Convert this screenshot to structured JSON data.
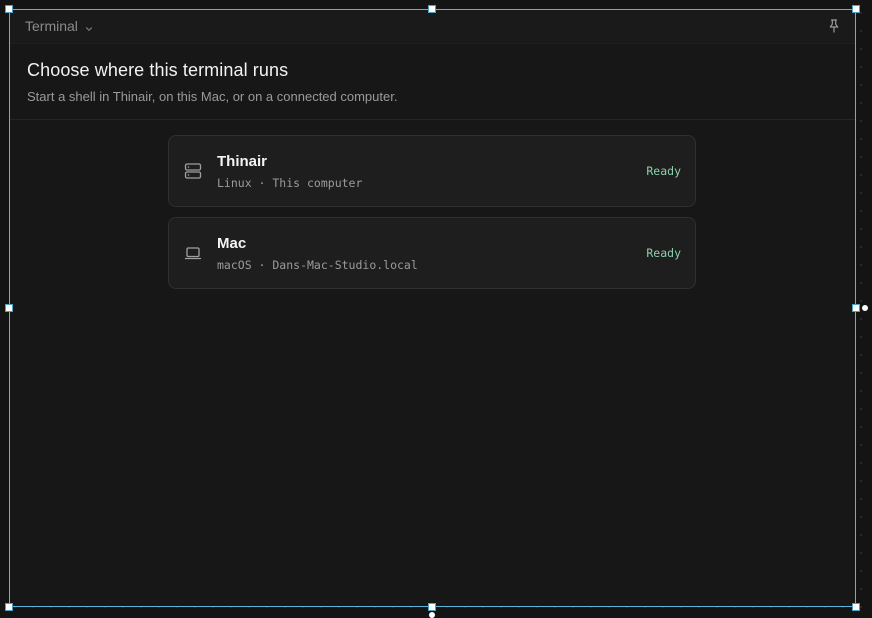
{
  "titlebar": {
    "title": "Terminal",
    "chevron_icon": "chevron-down-icon",
    "pin_icon": "pin-icon"
  },
  "header": {
    "title": "Choose where this terminal runs",
    "subtitle": "Start a shell in Thinair, on this Mac, or on a connected computer."
  },
  "targets": [
    {
      "name": "Thinair",
      "meta": "Linux · This computer",
      "status": "Ready",
      "icon": "server-icon"
    },
    {
      "name": "Mac",
      "meta": "macOS · Dans-Mac-Studio.local",
      "status": "Ready",
      "icon": "laptop-icon"
    }
  ],
  "colors": {
    "accent_selection": "#5bb5d6",
    "status_ready": "#8ecfae",
    "background": "#141414"
  }
}
